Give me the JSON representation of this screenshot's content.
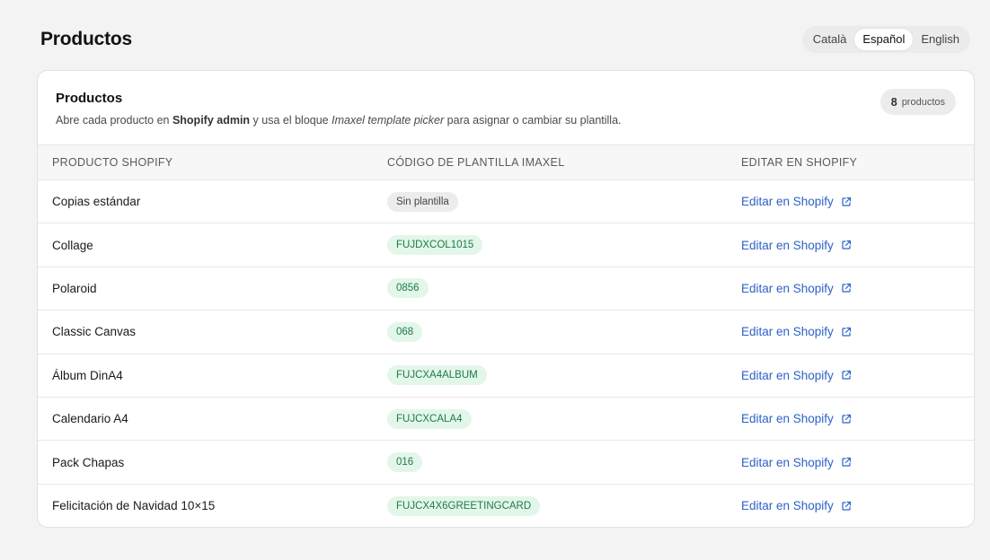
{
  "page": {
    "title": "Productos"
  },
  "languages": [
    {
      "label": "Català",
      "active": false
    },
    {
      "label": "Español",
      "active": true
    },
    {
      "label": "English",
      "active": false
    }
  ],
  "card": {
    "title": "Productos",
    "desc_prefix": "Abre cada producto en ",
    "desc_strong": "Shopify admin",
    "desc_mid": " y usa el bloque ",
    "desc_italic": "Imaxel template picker",
    "desc_suffix": " para asignar o cambiar su plantilla.",
    "count": "8",
    "count_label": "productos"
  },
  "table": {
    "headers": [
      "PRODUCTO SHOPIFY",
      "CÓDIGO DE PLANTILLA IMAXEL",
      "EDITAR EN SHOPIFY"
    ],
    "rows": [
      {
        "product": "Copias estándar",
        "template": "Sin plantilla",
        "has_template": false,
        "link": "Editar en Shopify"
      },
      {
        "product": "Collage",
        "template": "FUJDXCOL1015",
        "has_template": true,
        "link": "Editar en Shopify"
      },
      {
        "product": "Polaroid",
        "template": "0856",
        "has_template": true,
        "link": "Editar en Shopify"
      },
      {
        "product": "Classic Canvas",
        "template": "068",
        "has_template": true,
        "link": "Editar en Shopify"
      },
      {
        "product": "Álbum DinA4",
        "template": "FUJCXA4ALBUM",
        "has_template": true,
        "link": "Editar en Shopify"
      },
      {
        "product": "Calendario A4",
        "template": "FUJCXCALA4",
        "has_template": true,
        "link": "Editar en Shopify"
      },
      {
        "product": "Pack Chapas",
        "template": "016",
        "has_template": true,
        "link": "Editar en Shopify"
      },
      {
        "product": "Felicitación de Navidad 10×15",
        "template": "FUJCX4X6GREETINGCARD",
        "has_template": true,
        "link": "Editar en Shopify"
      }
    ]
  },
  "icons": {
    "external_link": "external-link-icon"
  },
  "colors": {
    "link": "#2c62c7",
    "template_bg": "#e3f6ea",
    "template_text": "#1e7a49"
  }
}
